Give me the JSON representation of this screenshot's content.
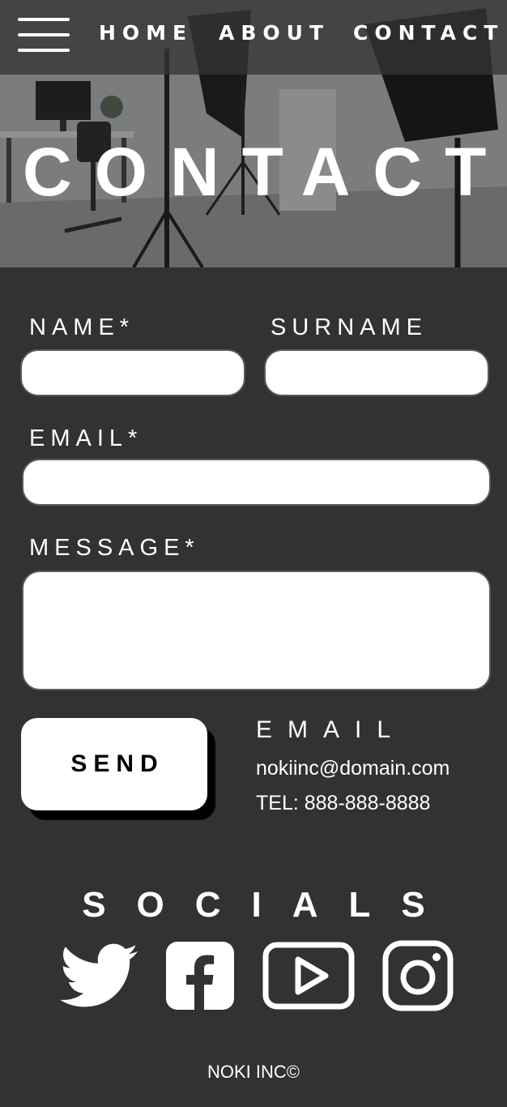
{
  "nav": {
    "menu_icon": "hamburger-menu-icon",
    "links": [
      "HOME",
      "ABOUT",
      "CONTACT"
    ]
  },
  "hero": {
    "title": "CONTACT",
    "image": "photo-studio-softbox-lights"
  },
  "form": {
    "name_label": "NAME*",
    "surname_label": "SURNAME",
    "email_label": "EMAIL*",
    "message_label": "MESSAGE*",
    "name_value": "",
    "surname_value": "",
    "email_value": "",
    "message_value": "",
    "send_label": "SEND"
  },
  "contact_info": {
    "heading": "EMAIL",
    "email": "nokiinc@domain.com",
    "tel": "TEL: 888-888-8888"
  },
  "socials": {
    "heading": "SOCIALS",
    "icons": [
      "twitter-icon",
      "facebook-icon",
      "youtube-icon",
      "instagram-icon"
    ]
  },
  "footer": {
    "text": "NOKI INC©"
  },
  "colors": {
    "background": "#323232",
    "nav_bar": "#343436",
    "text": "#ffffff",
    "field": "#ffffff",
    "send_shadow": "#000000"
  }
}
